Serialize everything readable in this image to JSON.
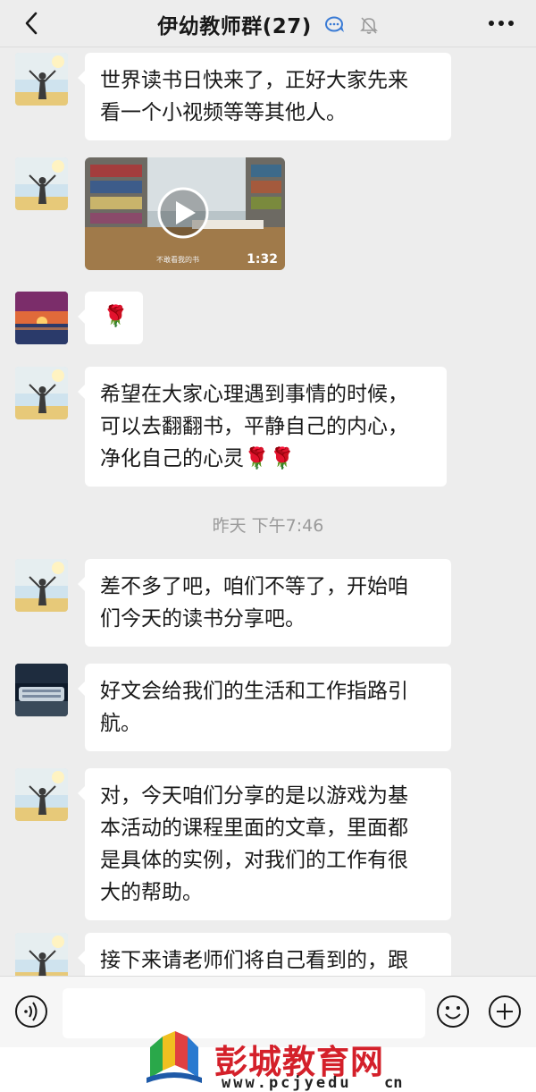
{
  "header": {
    "title": "伊幼教师群(27)",
    "icons": [
      "back-arrow-icon",
      "group-chat-icon",
      "mute-bell-icon",
      "more-icon"
    ]
  },
  "messages": [
    {
      "avatar": "avatar-girl-sky",
      "type": "text",
      "text_lines": [
        "世界读书日快来了，正好大家先来",
        "看一个小视频等等其他人。"
      ]
    },
    {
      "avatar": "avatar-girl-sky",
      "type": "video",
      "duration": "1:32",
      "caption": "不敢看我的书"
    },
    {
      "avatar": "avatar-sunset",
      "type": "emoji",
      "text_lines": [
        "🌹"
      ]
    },
    {
      "avatar": "avatar-girl-sky",
      "type": "text",
      "text_lines": [
        "希望在大家心理遇到事情的时候，",
        "可以去翻翻书，平静自己的内心，",
        "净化自己的心灵🌹🌹"
      ]
    },
    {
      "avatar": "avatar-girl-sky",
      "type": "text",
      "text_lines": [
        "差不多了吧，咱们不等了，开始咱",
        "们今天的读书分享吧。"
      ]
    },
    {
      "avatar": "avatar-stadium",
      "type": "text",
      "text_lines": [
        "好文会给我们的生活和工作指路引",
        "航。"
      ]
    },
    {
      "avatar": "avatar-girl-sky",
      "type": "text",
      "text_lines": [
        "对，今天咱们分享的是以游戏为基",
        "本活动的课程里面的文章，里面都",
        "是具体的实例，对我们的工作有很",
        "大的帮助。"
      ]
    },
    {
      "avatar": "avatar-girl-sky",
      "type": "text",
      "text_lines": [
        "接下来请老师们将自己看到的，跟"
      ]
    }
  ],
  "timestamp": "昨天 下午7:46",
  "input_bar": {
    "icons": [
      "voice-icon",
      "emoji-icon",
      "plus-icon"
    ],
    "placeholder": ""
  },
  "watermark": {
    "name": "彭城教育网",
    "url": "www.pcjyedu",
    "url_tail": "cn"
  },
  "colors": {
    "background": "#ededed",
    "bubble": "#ffffff",
    "timestamp": "#9a9a9a",
    "watermark_red": "#d4202a"
  }
}
